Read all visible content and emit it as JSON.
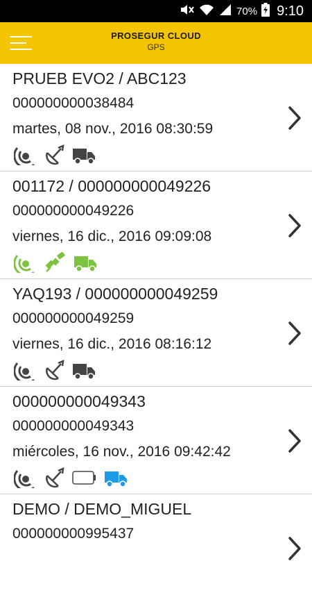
{
  "status_bar": {
    "battery_percent": "70%",
    "time": "9:10",
    "icons": [
      "mute-icon",
      "wifi-icon",
      "signal-icon",
      "battery-charging-icon"
    ]
  },
  "header": {
    "title": "PROSEGUR CLOUD",
    "subtitle": "GPS",
    "menu_icon": "hamburger-menu-icon"
  },
  "colors": {
    "header_bg": "#f5c400",
    "active_green": "#7dc242",
    "inactive_gray": "#444444",
    "truck_blue": "#1e9be6"
  },
  "items": [
    {
      "title": "PRUEB EVO2 / ABC123",
      "device_id": "000000000038484",
      "datetime": "martes, 08 nov., 2016 08:30:59",
      "status_icons": [
        "signal-gray-icon",
        "satellite-gray-icon",
        "truck-gray-icon"
      ]
    },
    {
      "title": "001172 / 000000000049226",
      "device_id": "000000000049226",
      "datetime": "viernes, 16 dic., 2016 09:09:08",
      "status_icons": [
        "signal-green-icon",
        "satellite-green-icon",
        "truck-green-icon"
      ]
    },
    {
      "title": "YAQ193 / 000000000049259",
      "device_id": "000000000049259",
      "datetime": "viernes, 16 dic., 2016 08:16:12",
      "status_icons": [
        "signal-gray-icon",
        "satellite-gray-icon",
        "truck-gray-icon"
      ]
    },
    {
      "title": "000000000049343",
      "device_id": "000000000049343",
      "datetime": "miércoles, 16 nov., 2016 09:42:42",
      "status_icons": [
        "signal-gray-icon",
        "satellite-gray-icon",
        "battery-empty-icon",
        "truck-blue-icon"
      ]
    },
    {
      "title": "DEMO / DEMO_MIGUEL",
      "device_id": "000000000995437",
      "datetime": "",
      "status_icons": []
    }
  ]
}
